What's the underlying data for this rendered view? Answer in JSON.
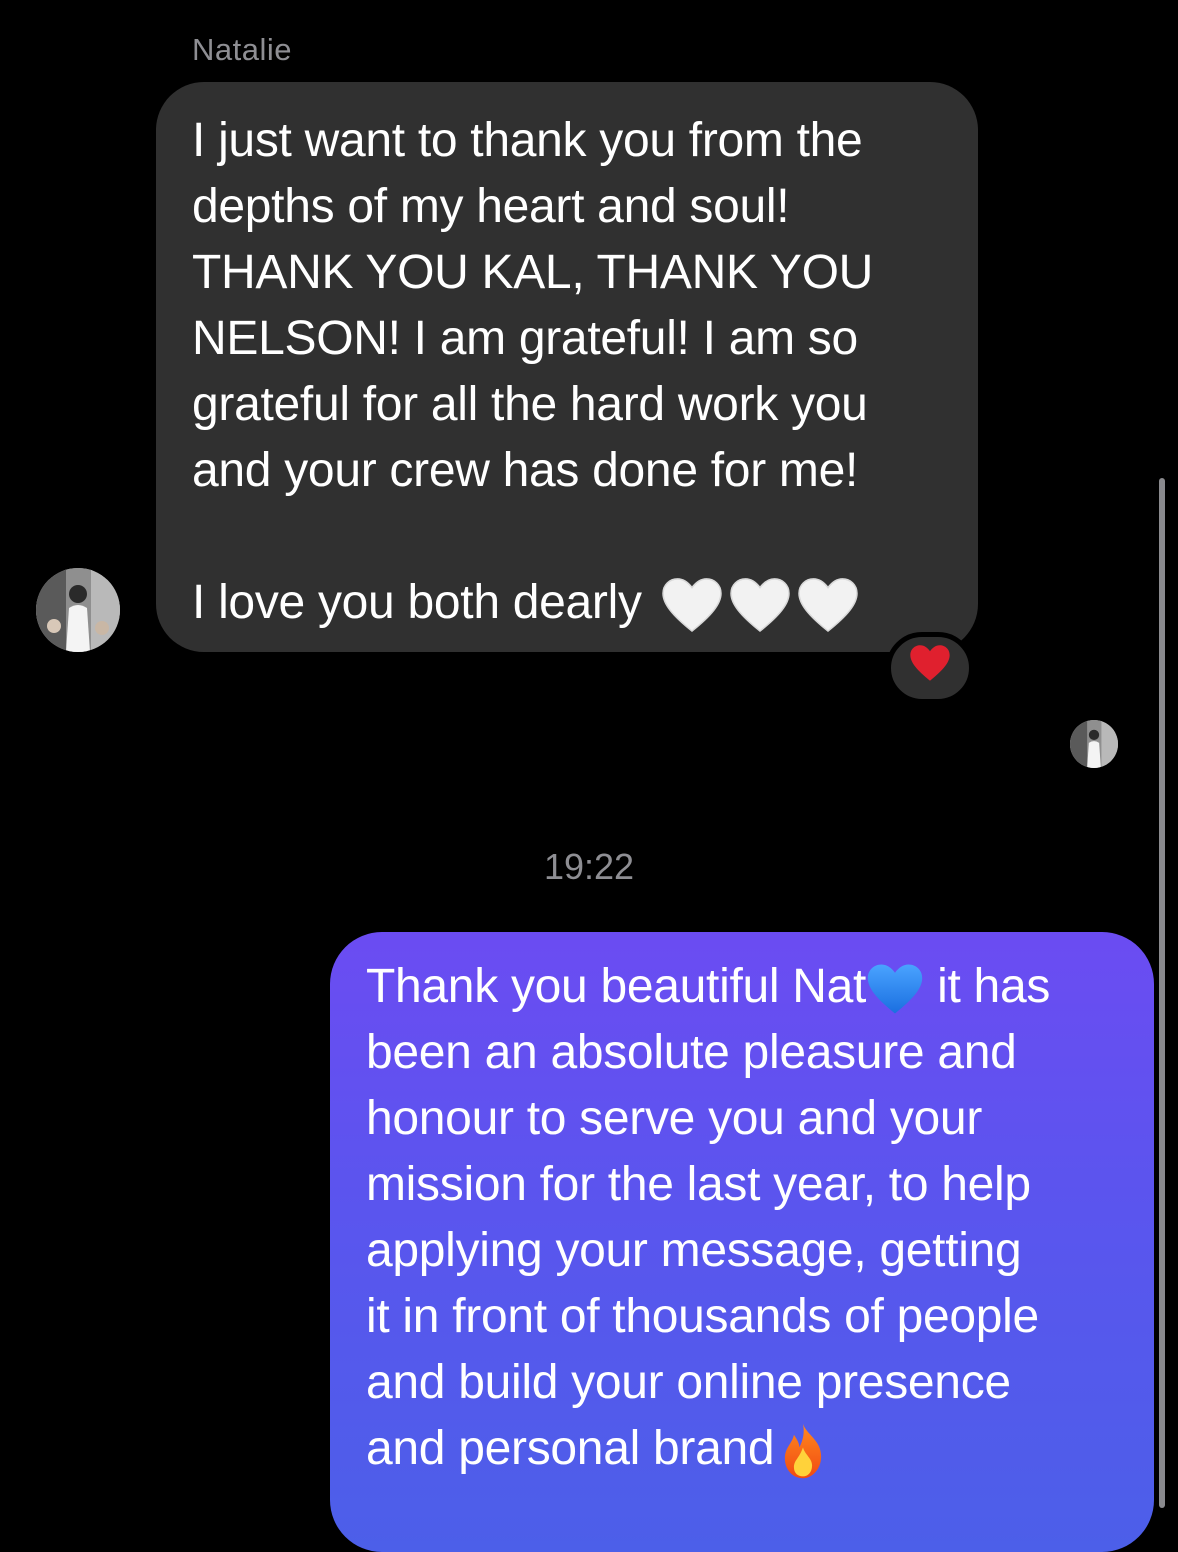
{
  "thread": {
    "sender_name": "Natalie",
    "incoming_message": {
      "text_main": "I just want to thank you from the\ndepths of my heart and soul!\nTHANK YOU KAL, THANK YOU\nNELSON! I am grateful! I am so\ngrateful for all the hard work you\nand your crew has done for me!\n\nI love you both dearly ",
      "trailing_emojis": [
        "white-heart-icon",
        "white-heart-icon",
        "white-heart-icon"
      ],
      "reaction_emoji": "❤️"
    },
    "timestamp": "19:22",
    "outgoing_message": {
      "text_part1": "Thank you beautiful Nat",
      "emoji1": "blue-heart-icon",
      "text_part2": " it has\nbeen an absolute pleasure and\nhonour to serve you and your\nmission for the last year, to help\napplying your message, getting\nit in front of thousands of people\nand build your online presence\nand personal brand",
      "emoji2": "fire-icon"
    }
  },
  "colors": {
    "background": "#000000",
    "incoming_bubble": "#303030",
    "outgoing_bubble_top": "#6b4cf2",
    "outgoing_bubble_bottom": "#4c5fe9",
    "secondary_text": "#8e8e93"
  }
}
